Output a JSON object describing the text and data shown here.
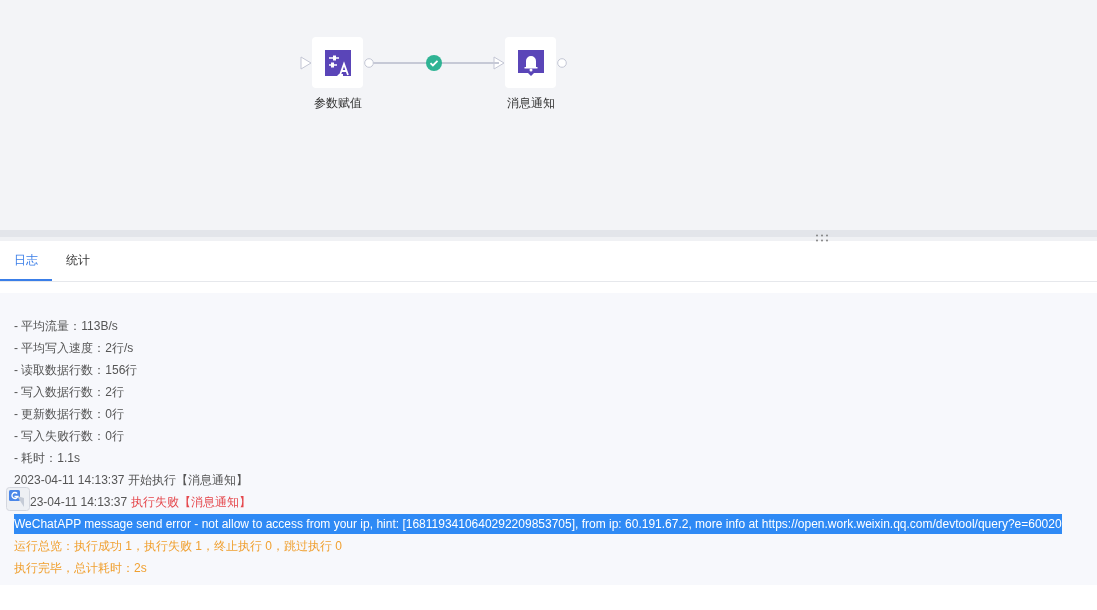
{
  "flow": {
    "nodes": [
      {
        "kind": "assign",
        "label": "参数赋值"
      },
      {
        "kind": "notify",
        "label": "消息通知"
      }
    ],
    "edges": [
      {
        "succeeded": true
      }
    ]
  },
  "tabs": [
    {
      "label": "日志",
      "selected": true
    },
    {
      "label": "统计",
      "selected": false
    }
  ],
  "log": [
    {
      "kind": "stat",
      "text": "- 平均流量：113B/s",
      "selected": false
    },
    {
      "kind": "stat",
      "text": "- 平均写入速度：2行/s",
      "selected": false
    },
    {
      "kind": "stat",
      "text": "- 读取数据行数：156行",
      "selected": false
    },
    {
      "kind": "stat",
      "text": "- 写入数据行数：2行",
      "selected": false
    },
    {
      "kind": "stat",
      "text": "- 更新数据行数：0行",
      "selected": false
    },
    {
      "kind": "stat",
      "text": "- 写入失败行数：0行",
      "selected": false
    },
    {
      "kind": "stat",
      "text": "- 耗时：1.1s",
      "selected": false
    },
    {
      "kind": "event",
      "time": "2023-04-11 14:13:37",
      "action": "开始执行",
      "node": "【消息通知】",
      "failed": false,
      "translate_badge": false,
      "selected": false
    },
    {
      "kind": "event",
      "time": "23-04-11 14:13:37",
      "action": "执行失败",
      "node": "【消息通知】",
      "failed": true,
      "translate_badge": true,
      "selected": false
    },
    {
      "kind": "stat",
      "text": "WeChatAPP message send error - not allow to access from your ip, hint: [1681193410640292209853705], from ip: 60.191.67.2, more info at https://open.work.weixin.qq.com/devtool/query?e=60020",
      "selected": true
    },
    {
      "kind": "summary",
      "text": "运行总览：执行成功 1，执行失败 1，终止执行 0，跳过执行 0",
      "selected": false
    },
    {
      "kind": "summary",
      "text": "执行完毕，总计耗时：2s",
      "selected": false
    }
  ]
}
